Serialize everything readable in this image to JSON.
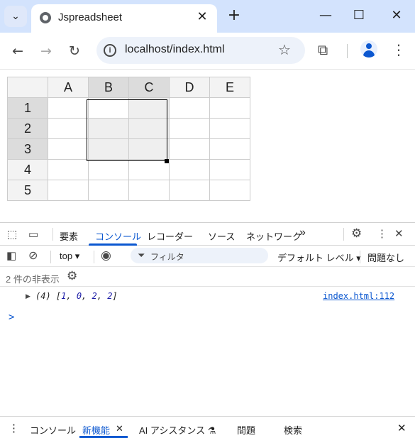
{
  "browser": {
    "tab_title": "Jspreadsheet",
    "url": "localhost/index.html",
    "colors": {
      "tabstrip": "#d3e3fd",
      "accent": "#0b57d0"
    }
  },
  "spreadsheet": {
    "columns": [
      "A",
      "B",
      "C",
      "D",
      "E"
    ],
    "rows": [
      "1",
      "2",
      "3",
      "4",
      "5"
    ],
    "selection": {
      "from": "B1",
      "to": "C3"
    }
  },
  "devtools": {
    "tabs": [
      "要素",
      "コンソール",
      "レコーダー",
      "ソース",
      "ネットワーク"
    ],
    "active_tab": "コンソール",
    "more_tabs": "»",
    "context": "top",
    "filter_placeholder": "フィルタ",
    "levels": "デフォルト レベル",
    "issues": "問題なし",
    "hidden_count": "2 件の非表示",
    "log": {
      "prefix": "(4) [",
      "values": [
        "1",
        "0",
        "2",
        "2"
      ],
      "suffix": "]",
      "source": "index.html:112"
    },
    "prompt": ">"
  },
  "drawer": {
    "tabs": [
      "コンソール",
      "新機能",
      "AI アシスタンス",
      "問題",
      "検索"
    ],
    "active_tab": "新機能"
  }
}
